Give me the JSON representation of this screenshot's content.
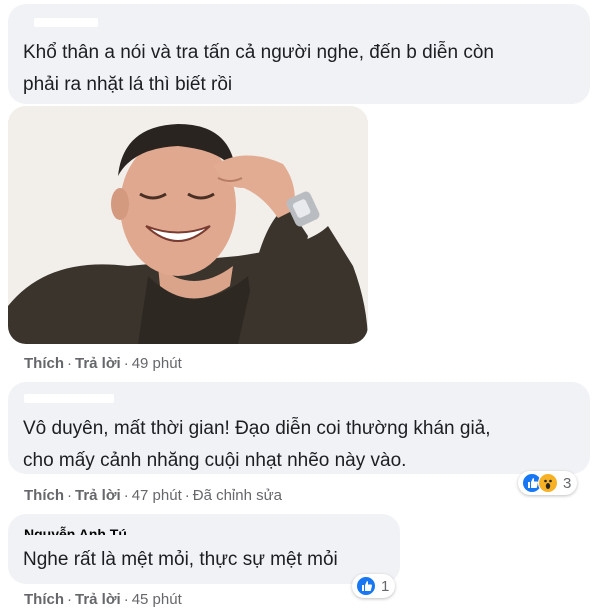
{
  "comments": [
    {
      "text_lines": [
        "Khổ thân a nói và tra tấn cả người nghe, đến b diễn còn",
        "phải ra nhặt lá thì biết rồi"
      ],
      "gif": "laughing-man-gif",
      "actions": {
        "like": "Thích",
        "reply": "Trả lời",
        "time": "49 phút"
      }
    },
    {
      "text_lines": [
        "Vô duyên, mất thời gian! Đạo diễn coi thường khán giả,",
        "cho mấy cảnh nhăng cuội nhạt nhẽo này vào."
      ],
      "actions": {
        "like": "Thích",
        "reply": "Trả lời",
        "time": "47 phút",
        "edited": "Đã chỉnh sửa"
      },
      "reactions": {
        "icons": [
          "like-icon",
          "wow-icon"
        ],
        "count": "3"
      }
    },
    {
      "author_partial": "Nguyễn Anh Tú",
      "text_lines": [
        "Nghe rất là mệt mỏi, thực sự mệt mỏi"
      ],
      "actions": {
        "like": "Thích",
        "reply": "Trả lời",
        "time": "45 phút"
      },
      "reactions": {
        "icons": [
          "like-icon"
        ],
        "count": "1"
      }
    }
  ],
  "colors": {
    "bubble": "#f0f2f5",
    "secondary_text": "#65676b",
    "like_blue": "#1877f2",
    "wow_yellow": "#f7b125"
  }
}
